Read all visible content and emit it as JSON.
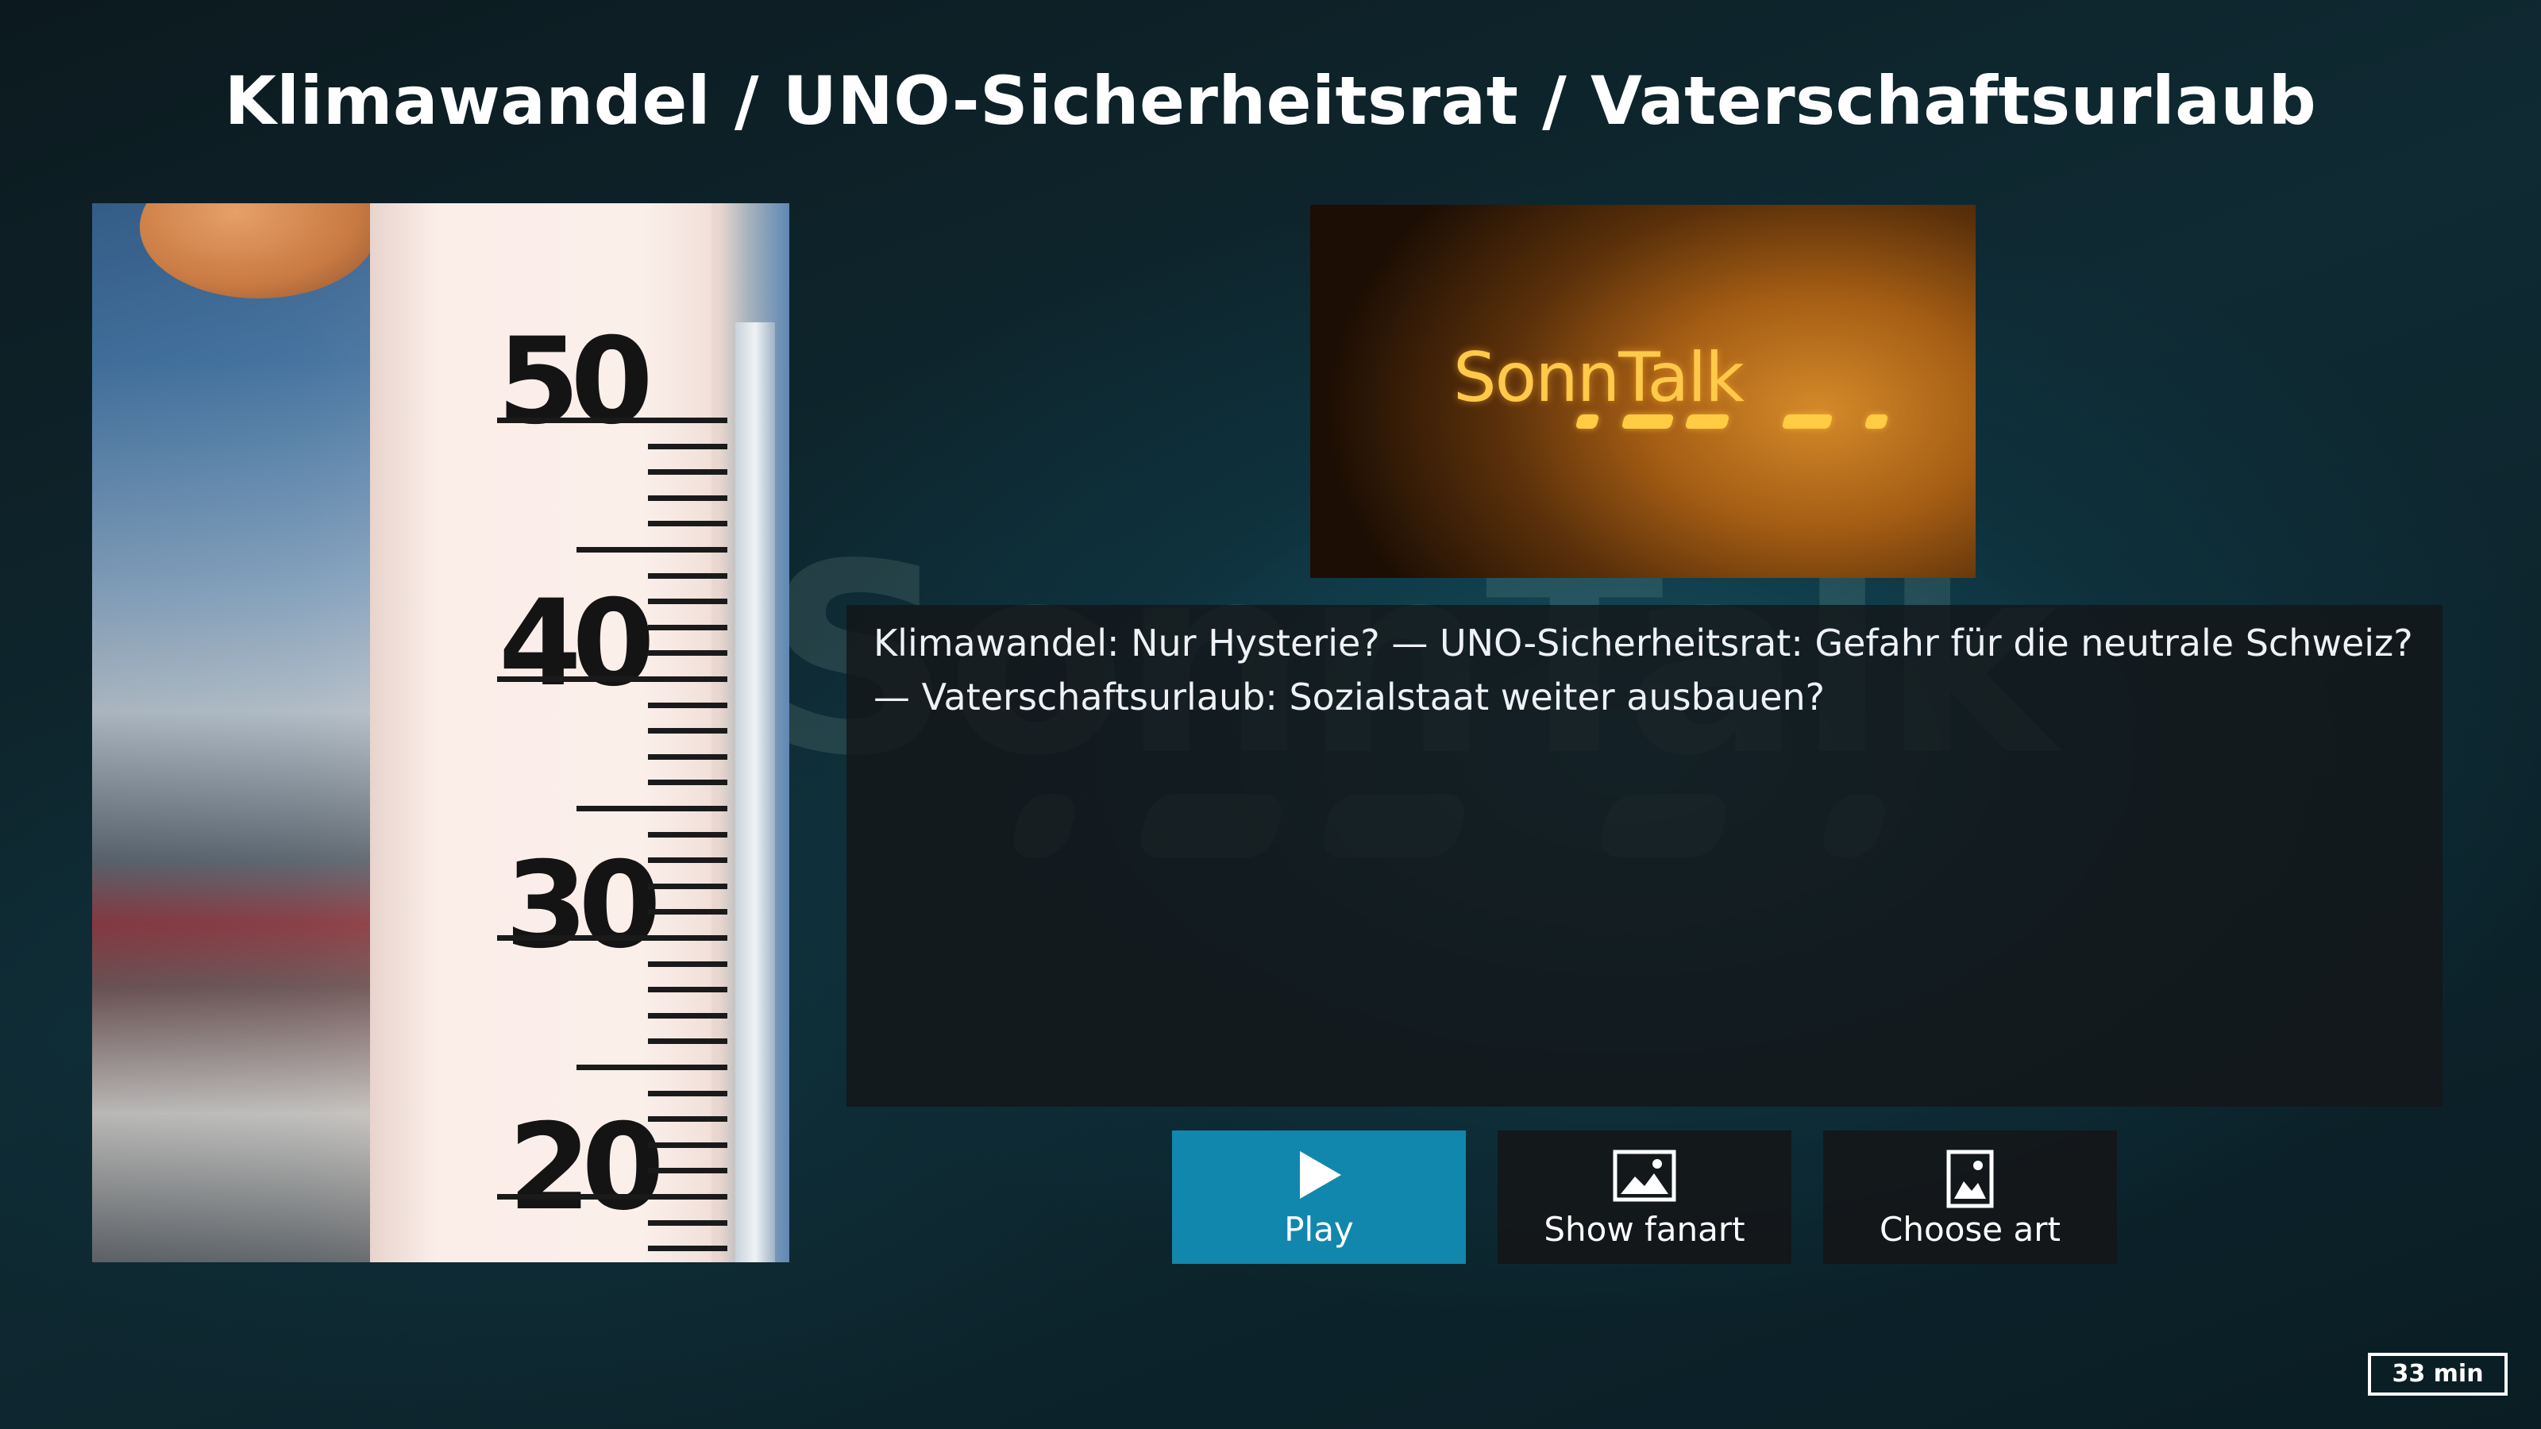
{
  "header": {
    "title": "Klimawandel / UNO-Sicherheitsrat / Vaterschaftsurlaub"
  },
  "poster": {
    "scale_numbers": [
      "50",
      "40",
      "30",
      "20"
    ]
  },
  "fanart": {
    "logo_text": "SonnTalk"
  },
  "plot": {
    "text": "Klimawandel: Nur Hysterie? — UNO-Sicherheitsrat: Gefahr für die neutrale Schweiz? — Vaterschaftsurlaub: Sozialstaat weiter ausbauen?"
  },
  "buttons": [
    {
      "label": "Play",
      "icon": "play-icon",
      "focused": true
    },
    {
      "label": "Show fanart",
      "icon": "image-icon"
    },
    {
      "label": "Choose art",
      "icon": "portrait-image-icon"
    }
  ],
  "duration": "33 min",
  "colors": {
    "focus": "#1287ad",
    "panel": "#141618",
    "logo": "#ffc94a"
  }
}
